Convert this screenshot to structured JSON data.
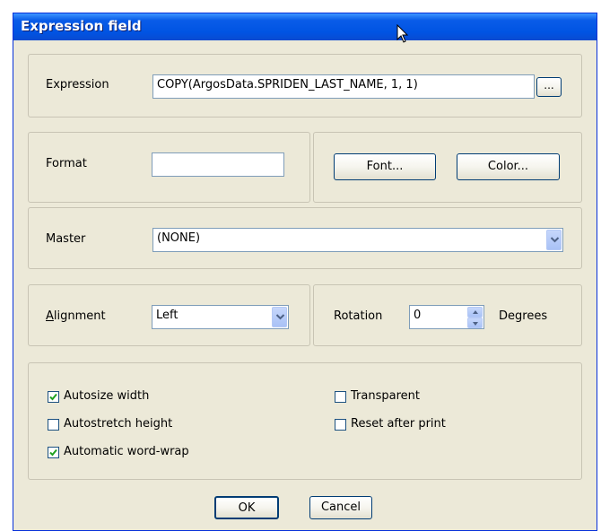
{
  "window": {
    "title": "Expression field"
  },
  "expression": {
    "label": "Expression",
    "value": "COPY(ArgosData.SPRIDEN_LAST_NAME, 1, 1)",
    "browse_label": "..."
  },
  "format": {
    "label": "Format",
    "value": ""
  },
  "buttons": {
    "font": "Font...",
    "color": "Color...",
    "ok": "OK",
    "cancel": "Cancel"
  },
  "master": {
    "label": "Master",
    "value": "(NONE)"
  },
  "alignment": {
    "label_first": "A",
    "label_rest": "lignment",
    "value": "Left"
  },
  "rotation": {
    "label": "Rotation",
    "value": "0",
    "unit": "Degrees"
  },
  "checkboxes": {
    "autosize_width": {
      "label": "Autosize width",
      "checked": true
    },
    "autostretch_height": {
      "label": "Autostretch height",
      "checked": false
    },
    "automatic_word_wrap": {
      "label": "Automatic word-wrap",
      "checked": true
    },
    "transparent": {
      "label": "Transparent",
      "checked": false
    },
    "reset_after_print": {
      "label": "Reset after print",
      "checked": false
    }
  },
  "icons": {
    "cursor": "mouse-pointer-icon",
    "dropdown": "chevron-down-icon",
    "check": "checkmark-icon"
  }
}
